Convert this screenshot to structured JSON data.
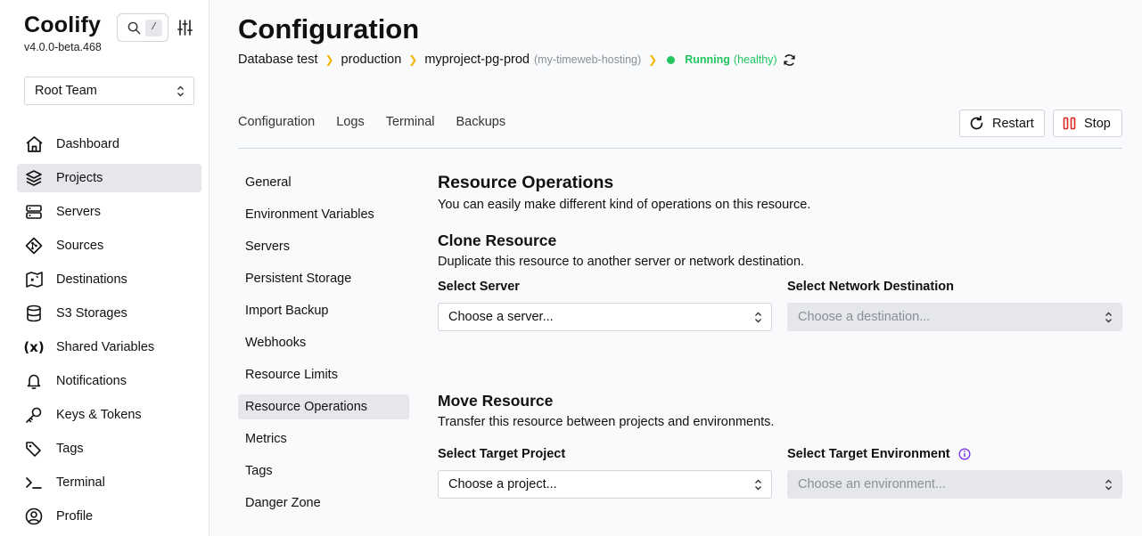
{
  "brand": {
    "name": "Coolify",
    "version": "v4.0.0-beta.468"
  },
  "search": {
    "shortcut": "/"
  },
  "team": {
    "selected": "Root Team"
  },
  "nav": [
    {
      "label": "Dashboard",
      "icon": "home-icon"
    },
    {
      "label": "Projects",
      "icon": "layers-icon",
      "active": true
    },
    {
      "label": "Servers",
      "icon": "server-icon"
    },
    {
      "label": "Sources",
      "icon": "git-icon"
    },
    {
      "label": "Destinations",
      "icon": "map-icon"
    },
    {
      "label": "S3 Storages",
      "icon": "database-icon"
    },
    {
      "label": "Shared Variables",
      "icon": "variable-icon"
    },
    {
      "label": "Notifications",
      "icon": "bell-icon"
    },
    {
      "label": "Keys & Tokens",
      "icon": "key-icon"
    },
    {
      "label": "Tags",
      "icon": "tag-icon"
    },
    {
      "label": "Terminal",
      "icon": "terminal-icon"
    },
    {
      "label": "Profile",
      "icon": "user-icon"
    }
  ],
  "page": {
    "title": "Configuration"
  },
  "breadcrumb": {
    "project": "Database test",
    "environment": "production",
    "resource": "myproject-pg-prod",
    "server": "(my-timeweb-hosting)",
    "status": "Running",
    "health": "(healthy)"
  },
  "tabs": [
    "Configuration",
    "Logs",
    "Terminal",
    "Backups"
  ],
  "actions": {
    "restart": "Restart",
    "stop": "Stop"
  },
  "subnav": [
    "General",
    "Environment Variables",
    "Servers",
    "Persistent Storage",
    "Import Backup",
    "Webhooks",
    "Resource Limits",
    "Resource Operations",
    "Metrics",
    "Tags",
    "Danger Zone"
  ],
  "subnav_active": "Resource Operations",
  "operations": {
    "title": "Resource Operations",
    "description": "You can easily make different kind of operations on this resource.",
    "clone": {
      "title": "Clone Resource",
      "description": "Duplicate this resource to another server or network destination.",
      "server_label": "Select Server",
      "server_placeholder": "Choose a server...",
      "destination_label": "Select Network Destination",
      "destination_placeholder": "Choose a destination..."
    },
    "move": {
      "title": "Move Resource",
      "description": "Transfer this resource between projects and environments.",
      "project_label": "Select Target Project",
      "project_placeholder": "Choose a project...",
      "environment_label": "Select Target Environment",
      "environment_placeholder": "Choose an environment..."
    }
  },
  "colors": {
    "status_green": "#22c55e",
    "breadcrumb_chevron": "#f5b50a",
    "info_purple": "#7c3aed",
    "stop_red": "#dc2626"
  }
}
